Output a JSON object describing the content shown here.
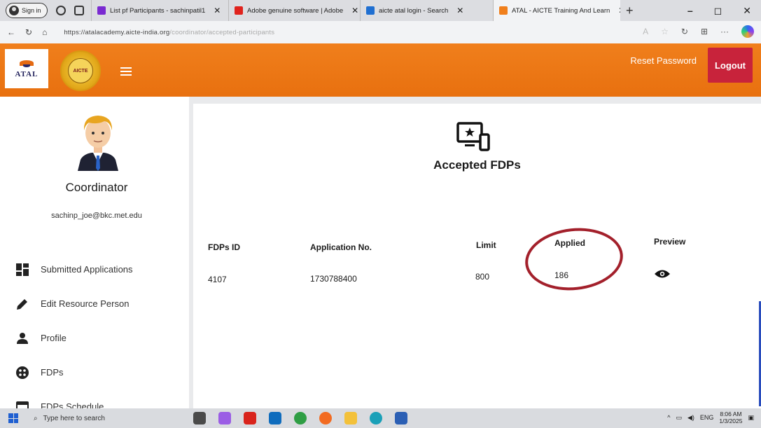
{
  "browser": {
    "signin_label": "Sign in",
    "tabs": [
      {
        "title": "List pf Participants - sachinpatil1",
        "favicon_color": "#7a2ad1",
        "active": false
      },
      {
        "title": "Adobe genuine software | Adobe",
        "favicon_color": "#e0231d",
        "active": false
      },
      {
        "title": "aicte atal login - Search",
        "favicon_color": "#1f6fd1",
        "active": false
      },
      {
        "title": "ATAL - AICTE Training And Learn",
        "favicon_color": "#f07f1c",
        "active": true
      }
    ],
    "new_tab": "+",
    "window_controls": [
      "–",
      "◻",
      "✕"
    ],
    "url_main": "https://atalacademy.aicte-india.org",
    "url_rest": "/coordinator/accepted-participants"
  },
  "header": {
    "logo_text": "ATAL",
    "seal_text": "AICTE",
    "reset_password": "Reset Password",
    "logout": "Logout",
    "accent": "#f07f1c",
    "logout_color": "#c8233b"
  },
  "sidebar": {
    "role": "Coordinator",
    "email": "sachinp_joe@bkc.met.edu",
    "items": [
      {
        "label": "Submitted Applications",
        "icon": "dashboard-icon"
      },
      {
        "label": "Edit Resource Person",
        "icon": "pencil-icon"
      },
      {
        "label": "Profile",
        "icon": "person-icon"
      },
      {
        "label": "FDPs",
        "icon": "circle-dots-icon"
      },
      {
        "label": "FDPs Schedule",
        "icon": "calendar-icon"
      }
    ]
  },
  "main": {
    "title": "Accepted FDPs",
    "columns": [
      "FDPs ID",
      "Application No.",
      "Limit",
      "Applied",
      "Preview"
    ],
    "rows": [
      {
        "fdp_id": "4107",
        "application_no": "1730788400",
        "limit": "800",
        "applied": "186",
        "preview": "eye-icon"
      }
    ]
  },
  "taskbar": {
    "search_placeholder": "Type here to search",
    "tray_lang": "ENG",
    "time": "8:06 AM",
    "date": "1/3/2025"
  }
}
